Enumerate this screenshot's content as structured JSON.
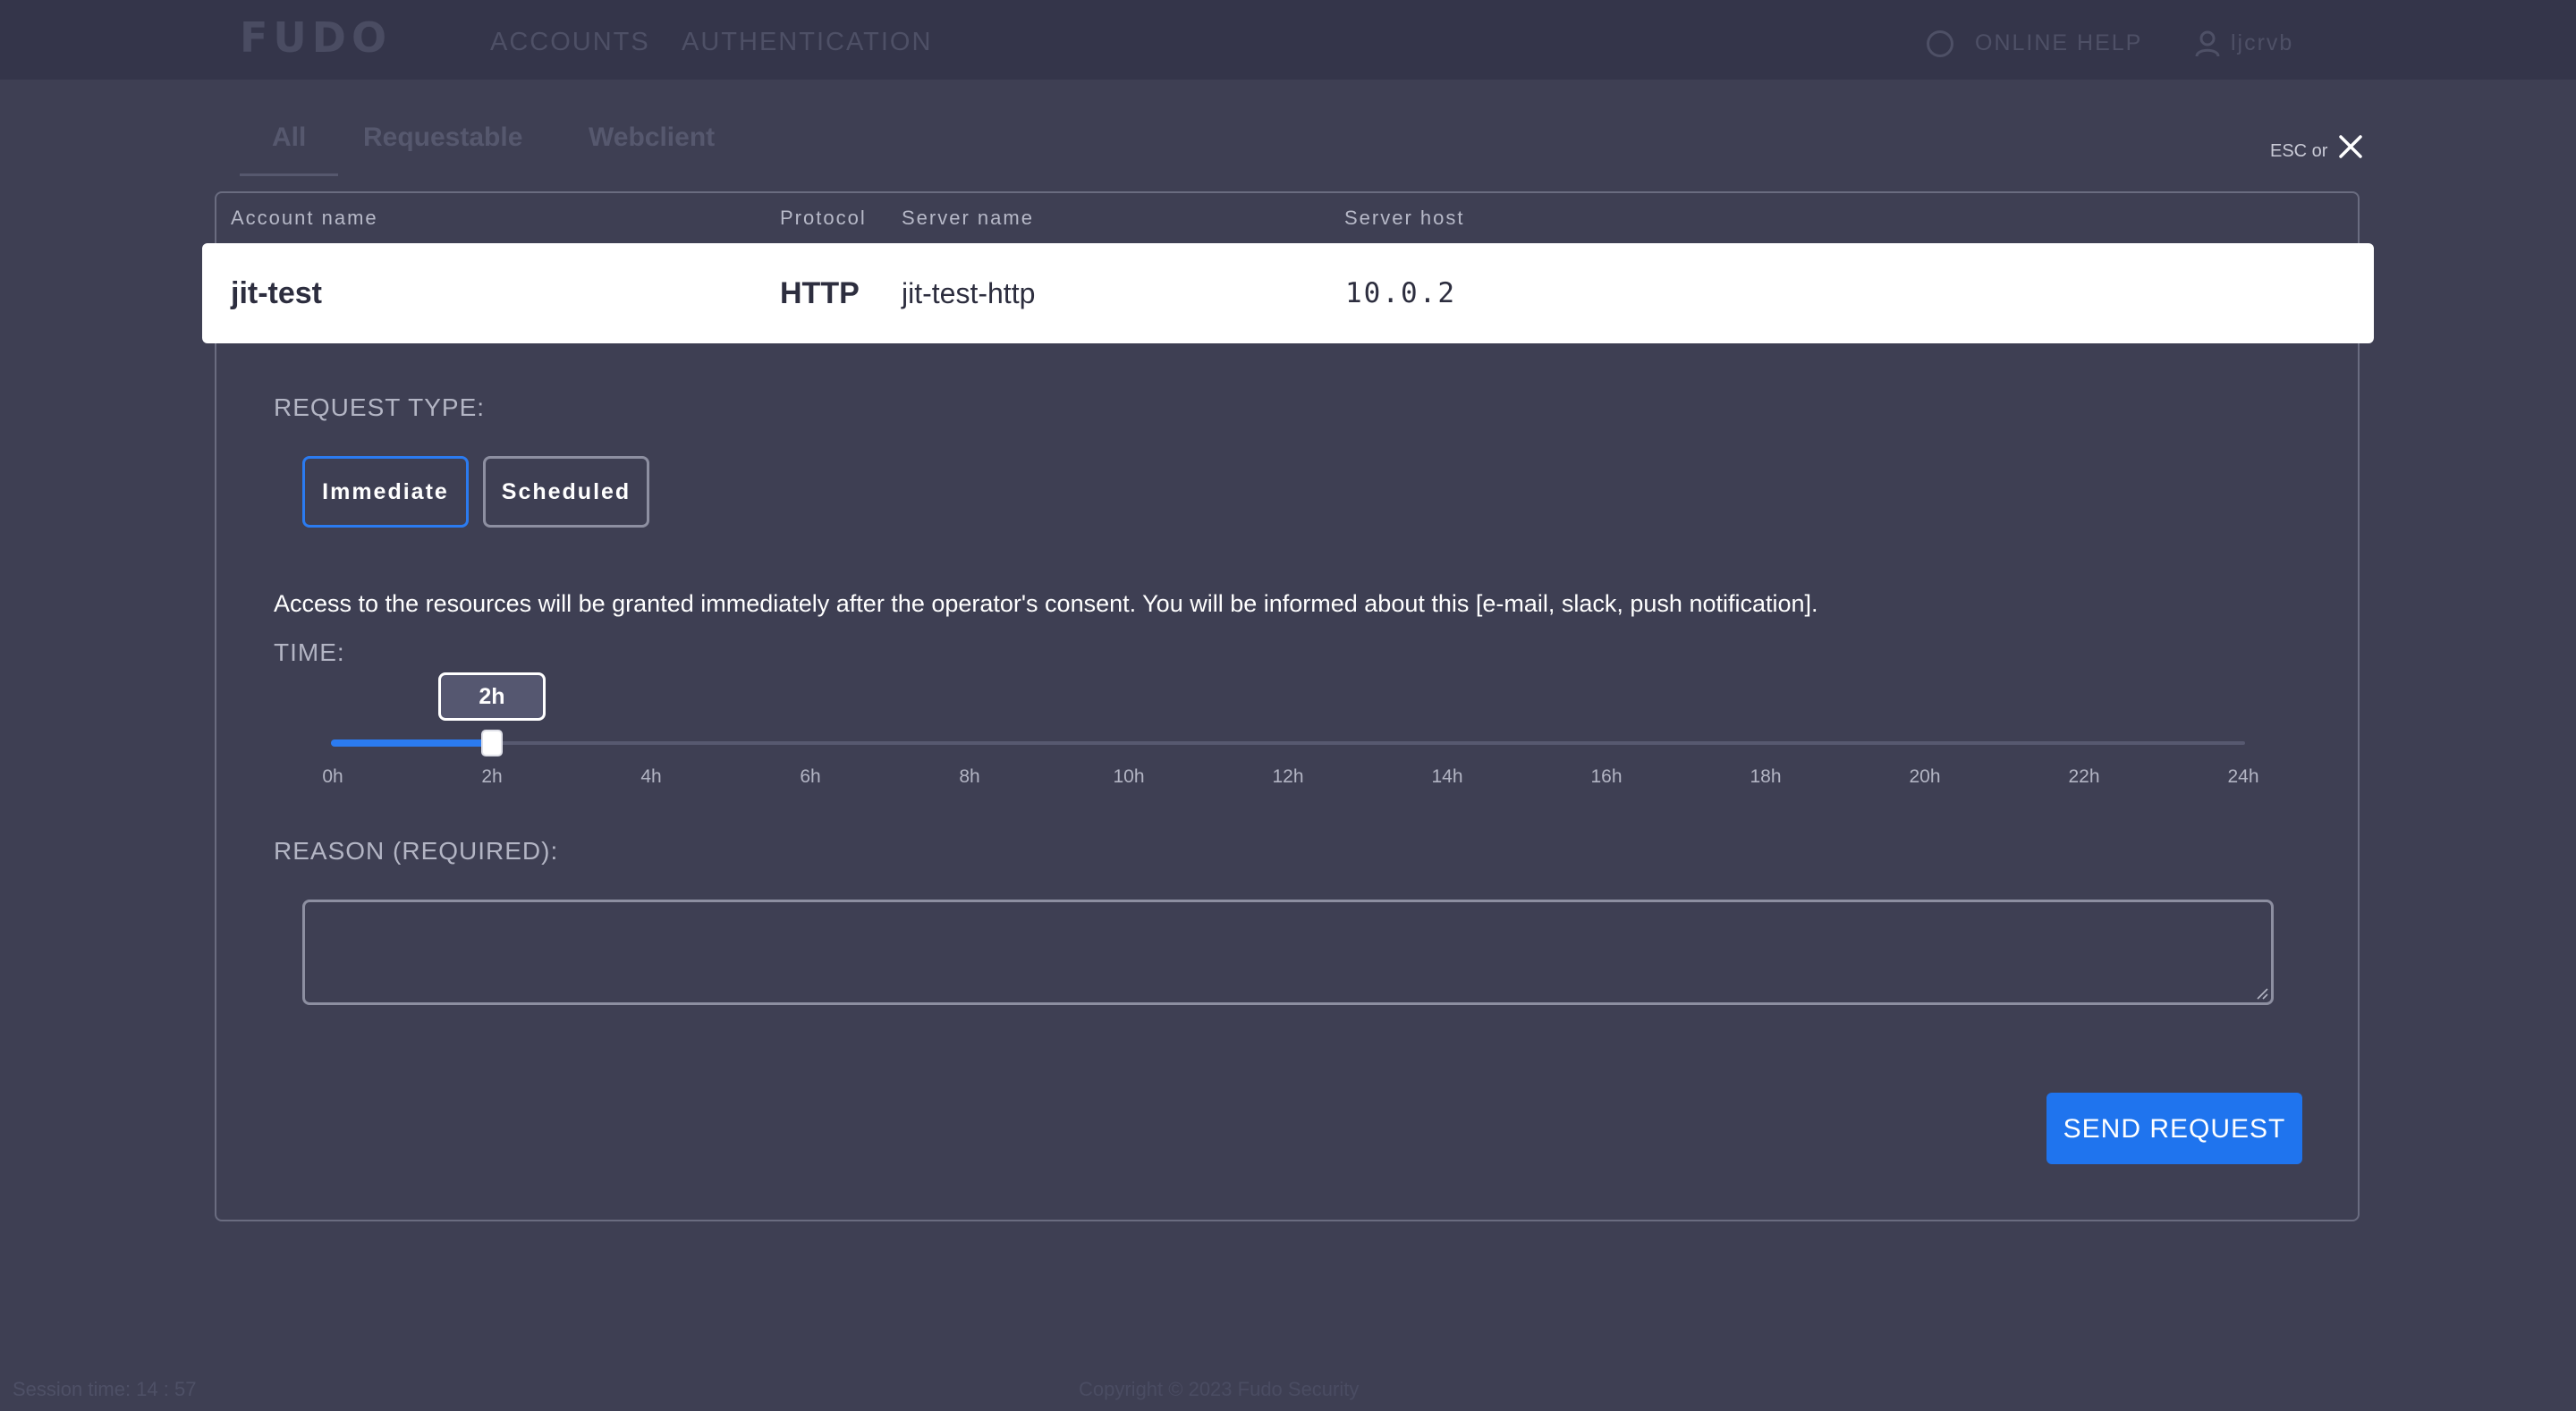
{
  "topbar": {
    "logo": "FUDO",
    "nav": [
      "ACCOUNTS",
      "AUTHENTICATION"
    ],
    "online_help": "ONLINE HELP",
    "user": "ljcrvb"
  },
  "tabs": [
    "All",
    "Requestable",
    "Webclient"
  ],
  "close": {
    "esc_label": "ESC or"
  },
  "table": {
    "headers": {
      "account_name": "Account name",
      "protocol": "Protocol",
      "server_name": "Server name",
      "server_host": "Server host"
    },
    "row": {
      "account_name": "jit-test",
      "protocol": "HTTP",
      "server_name": "jit-test-http",
      "server_host": "10.0.2"
    }
  },
  "request": {
    "type_label": "REQUEST TYPE:",
    "types": [
      "Immediate",
      "Scheduled"
    ],
    "selected_type": "Immediate",
    "info": "Access to the resources will be granted immediately after the operator's consent. You will be informed about this [e-mail, slack, push notification].",
    "time_label": "TIME:",
    "time": {
      "value_label": "2h",
      "value_hours": 2,
      "max_hours": 24,
      "ticks": [
        "0h",
        "2h",
        "4h",
        "6h",
        "8h",
        "10h",
        "12h",
        "14h",
        "16h",
        "18h",
        "20h",
        "22h",
        "24h"
      ]
    },
    "reason_label": "REASON (REQUIRED):",
    "reason_value": "",
    "send_label": "SEND REQUEST"
  },
  "footer": {
    "session": "Session time: 14 : 57",
    "copyright": "Copyright © 2023 Fudo Security"
  },
  "colors": {
    "background": "#3e3f53",
    "accent": "#1f74ee",
    "row_background": "#ffffff"
  }
}
